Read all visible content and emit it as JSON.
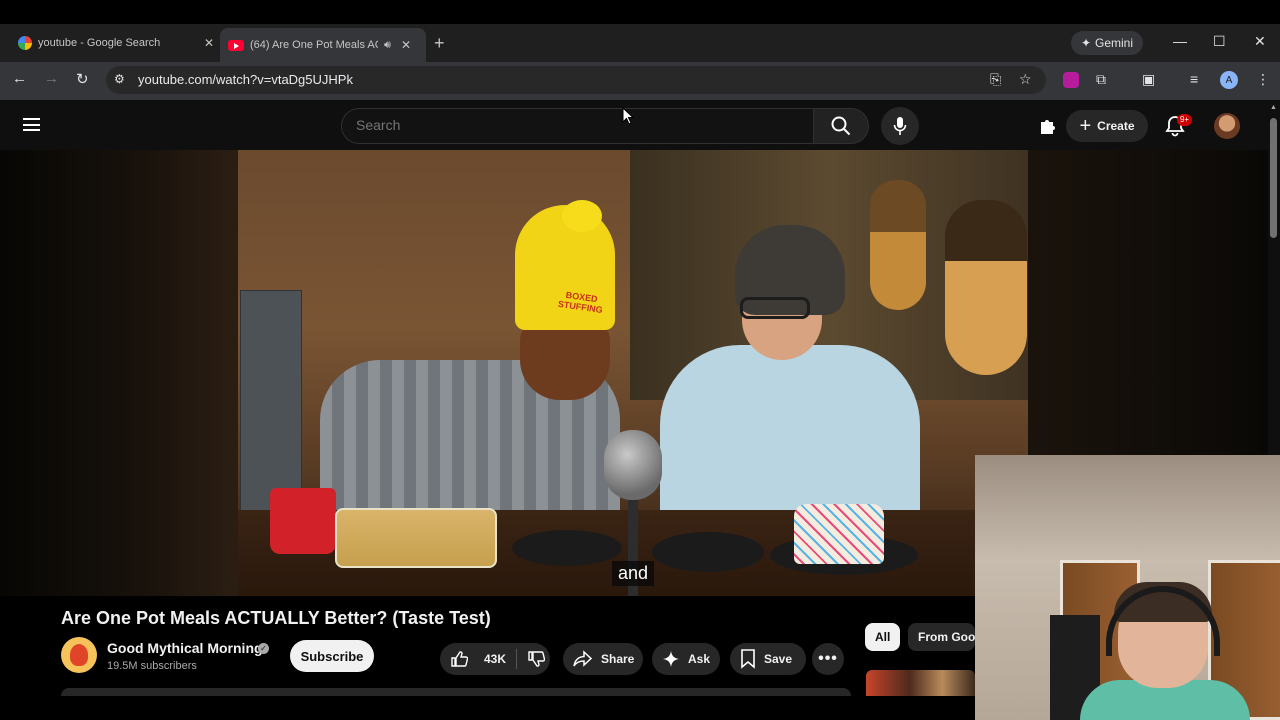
{
  "browser": {
    "tabs": [
      {
        "title": "youtube - Google Search",
        "favicon": "google-icon",
        "active": false
      },
      {
        "title": "(64) Are One Pot Meals ACT",
        "favicon": "youtube-icon",
        "active": true,
        "audio": true
      }
    ],
    "gemini_label": "Gemini",
    "url": "youtube.com/watch?v=vtaDg5UJHPk",
    "profile_initial": "A"
  },
  "youtube": {
    "search_placeholder": "Search",
    "create_label": "Create",
    "notification_badge": "9+"
  },
  "video": {
    "caption": "and",
    "hat_text": "BOXED STUFFING"
  },
  "watch": {
    "title": "Are One Pot Meals ACTUALLY Better? (Taste Test)",
    "channel_name": "Good Mythical Morning",
    "verified": true,
    "subscribers": "19.5M subscribers",
    "subscribe_label": "Subscribe",
    "likes": "43K",
    "share_label": "Share",
    "ask_label": "Ask",
    "save_label": "Save",
    "chips": [
      "All",
      "From Good"
    ]
  },
  "colors": {
    "youtube_red": "#ff0033",
    "background": "#0f0f0f",
    "pill": "#272727",
    "badge": "#cc0000"
  }
}
